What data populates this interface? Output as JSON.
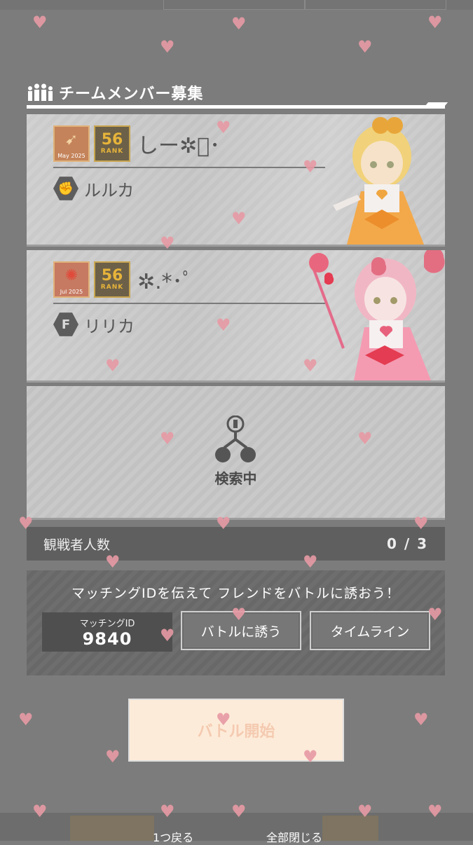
{
  "panel": {
    "title": "チームメンバー募集",
    "title_icon": "team-members-icon"
  },
  "members": [
    {
      "month_badge": "May 2025",
      "rank_number": "56",
      "rank_word": "RANK",
      "player_name": "しー✲ﾟ･",
      "character_name": "ルルカ",
      "character_icon": "fist-icon"
    },
    {
      "month_badge": "Jul 2025",
      "rank_number": "56",
      "rank_word": "RANK",
      "player_name": "✲.*･ﾟ",
      "character_name": "リリカ",
      "character_icon": "letter-f-icon"
    }
  ],
  "searching": {
    "label": "検索中",
    "icon": "searching-person-icon"
  },
  "spectators": {
    "label": "観戦者人数",
    "count": "0 / 3"
  },
  "invite": {
    "message": "マッチングIDを伝えて フレンドをバトルに誘おう！",
    "match_id_label": "マッチングID",
    "match_id_value": "9840",
    "invite_button": "バトルに誘う",
    "timeline_button": "タイムライン"
  },
  "start_button": "バトル開始",
  "bottom": {
    "back": "1つ戻る",
    "close_all": "全部閉じる"
  },
  "colors": {
    "overlay": "#7c7c7c",
    "heart": "#e79aa4",
    "start_button_bg": "#fdebd9",
    "rank_gold": "#e7b43a"
  }
}
